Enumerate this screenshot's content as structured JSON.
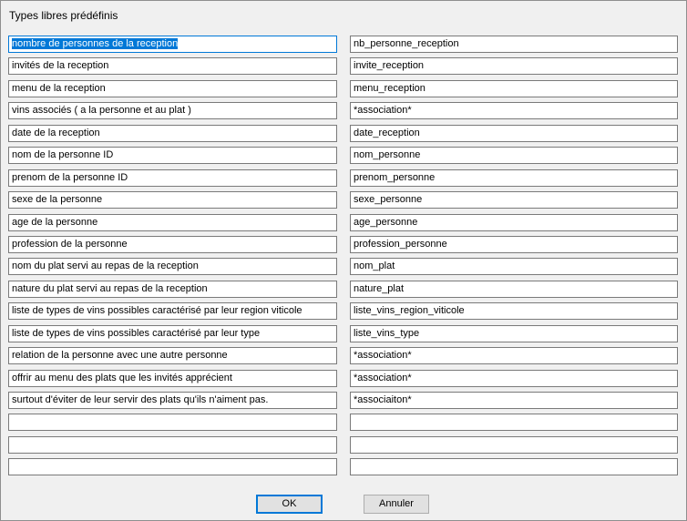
{
  "dialog": {
    "title": "Types libres prédéfinis"
  },
  "rows": [
    {
      "description": "nombre de personnes de la reception",
      "identifier": "nb_personne_reception"
    },
    {
      "description": "invités de la reception",
      "identifier": "invite_reception"
    },
    {
      "description": "menu de la reception",
      "identifier": "menu_reception"
    },
    {
      "description": "vins associés ( a la personne et au plat )",
      "identifier": "*association*"
    },
    {
      "description": "date de la reception",
      "identifier": "date_reception"
    },
    {
      "description": "nom de la personne ID",
      "identifier": "nom_personne"
    },
    {
      "description": "prenom de la personne ID",
      "identifier": "prenom_personne"
    },
    {
      "description": "sexe de la personne",
      "identifier": "sexe_personne"
    },
    {
      "description": "age de la personne",
      "identifier": "age_personne"
    },
    {
      "description": "profession de la personne",
      "identifier": "profession_personne"
    },
    {
      "description": "nom du plat servi au repas de la reception",
      "identifier": "nom_plat"
    },
    {
      "description": "nature du plat servi au repas de la reception",
      "identifier": "nature_plat"
    },
    {
      "description": "liste de types de vins possibles caractérisé par leur region viticole",
      "identifier": "liste_vins_region_viticole"
    },
    {
      "description": "liste de types de vins possibles caractérisé par leur type",
      "identifier": "liste_vins_type"
    },
    {
      "description": "relation de la personne avec une autre personne",
      "identifier": "*association*"
    },
    {
      "description": "offrir au menu des plats que les invités apprécient",
      "identifier": "*association*"
    },
    {
      "description": "surtout d'éviter de leur servir des plats qu'ils n'aiment pas.",
      "identifier": "*associaiton*"
    },
    {
      "description": "",
      "identifier": ""
    },
    {
      "description": "",
      "identifier": ""
    },
    {
      "description": "",
      "identifier": ""
    }
  ],
  "buttons": {
    "ok_label": "OK",
    "cancel_label": "Annuler"
  },
  "colors": {
    "focus": "#0078d7",
    "dialog_bg": "#f0f0f0"
  }
}
